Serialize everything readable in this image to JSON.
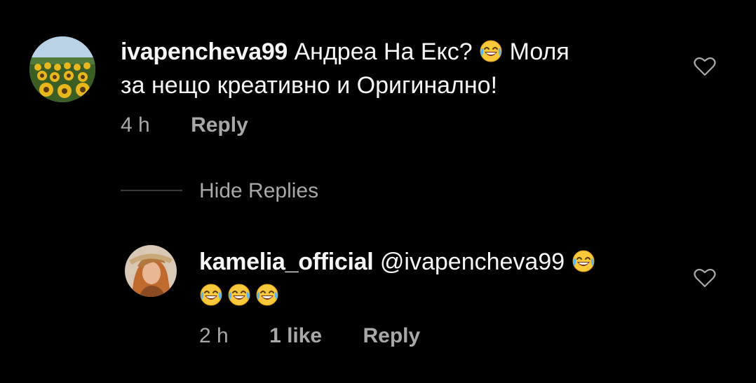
{
  "comments": [
    {
      "username": "ivapencheva99",
      "text_part1": "Андреа На Екс?",
      "text_part2": "Моля",
      "text_line2": "за нещо креативно и Оригинално!",
      "time": "4 h",
      "reply_label": "Reply"
    }
  ],
  "replies_toggle": {
    "label": "Hide Replies"
  },
  "replies": [
    {
      "username": "kamelia_official",
      "mention": "@ivapencheva99",
      "time": "2 h",
      "likes": "1 like",
      "reply_label": "Reply"
    }
  ],
  "emoji_name": "face-with-tears-of-joy",
  "colors": {
    "background": "#000000",
    "text": "#f5f5f5",
    "secondary": "#a8a8a8",
    "divider": "#3a3a3a"
  }
}
